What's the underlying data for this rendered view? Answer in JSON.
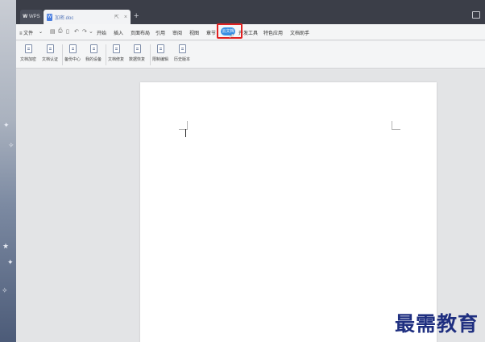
{
  "titlebar": {
    "wps_tab_label": "WPS",
    "doc_tab_label": "加密.doc",
    "doc_tab_pin": "⇱",
    "doc_tab_close": "×",
    "add_tab": "+"
  },
  "menubar": {
    "file": "≡ 文件",
    "file_arrow": "⌄",
    "items": [
      "开始",
      "插入",
      "页面布局",
      "引用",
      "审阅",
      "视图",
      "章节",
      "开发工具",
      "特色应用",
      "文档助手"
    ],
    "cloud_label": "云文档"
  },
  "ribbon": {
    "buttons": [
      "文档加密",
      "文档认证",
      "备份中心",
      "我的设备",
      "文档修复",
      "数据恢复",
      "限制编辑",
      "历史版本"
    ]
  },
  "watermark": "最需教育"
}
